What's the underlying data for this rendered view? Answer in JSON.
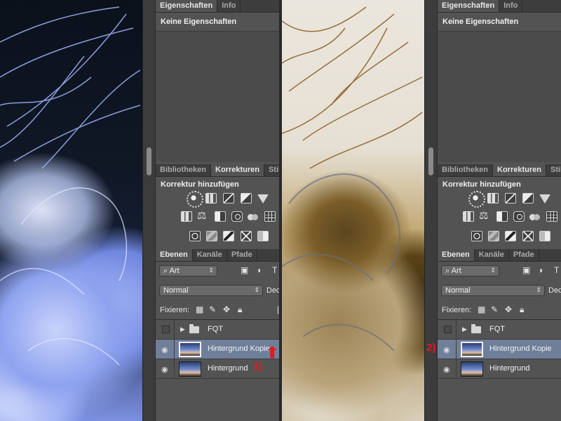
{
  "left_pane": {
    "tabs_top": [
      "Eigenschaften",
      "Info"
    ],
    "properties_text": "Keine Eigenschaften",
    "tabs_mid": [
      "Bibliotheken",
      "Korrekturen",
      "Stil"
    ],
    "corrections_title": "Korrektur hinzufügen",
    "tabs_layers": [
      "Ebenen",
      "Kanäle",
      "Pfade"
    ],
    "filter_value": "Art",
    "blend_mode": "Normal",
    "opacity_label": "Dec",
    "lock_label": "Fixieren:",
    "layers": [
      {
        "name": "FQT",
        "type": "group",
        "visible": false,
        "selected": false
      },
      {
        "name": "Hintergrund Kopie",
        "type": "layer",
        "visible": true,
        "selected": true
      },
      {
        "name": "Hintergrund",
        "type": "layer",
        "visible": true,
        "selected": false
      }
    ],
    "annotation": "1)"
  },
  "right_pane": {
    "tabs_top": [
      "Eigenschaften",
      "Info"
    ],
    "properties_text": "Keine Eigenschaften",
    "tabs_mid": [
      "Bibliotheken",
      "Korrekturen",
      "Stil"
    ],
    "corrections_title": "Korrektur hinzufügen",
    "tabs_layers": [
      "Ebenen",
      "Kanäle",
      "Pfade"
    ],
    "filter_value": "Art",
    "blend_mode": "Normal",
    "opacity_label": "Dec",
    "lock_label": "Fixieren:",
    "layers": [
      {
        "name": "FQT",
        "type": "group",
        "visible": false,
        "selected": false
      },
      {
        "name": "Hintergrund Kopie",
        "type": "layer",
        "visible": true,
        "selected": true
      },
      {
        "name": "Hintergrund",
        "type": "layer",
        "visible": true,
        "selected": false
      }
    ],
    "annotation": "2)"
  },
  "icons": {
    "eye": "eye-icon",
    "lock": "lock-icon",
    "move": "move-icon",
    "brush": "brush-icon",
    "checker": "transparency-lock-icon",
    "search": "search-icon",
    "folder": "folder-icon",
    "arrow": "up-arrow-icon"
  },
  "colors": {
    "panel_bg": "#535353",
    "tab_bg": "#3d3d3d",
    "selected_layer": "#6f7f9a",
    "annotation_red": "#e21b1b"
  }
}
